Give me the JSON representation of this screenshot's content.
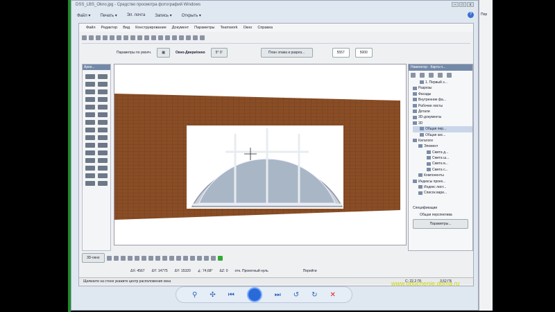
{
  "window": {
    "title": "DSS_LBS_Okno.jpg - Средство просмотра фотографий Windows"
  },
  "viewer_menu": [
    "Файл ▾",
    "Печать ▾",
    "Эл. почта",
    "Запись ▾",
    "Открыть ▾"
  ],
  "archicad": {
    "menu": [
      "Файл",
      "Редактор",
      "Вид",
      "Конструирование",
      "Документ",
      "Параметры",
      "Teamwork",
      "Окно",
      "Справка"
    ],
    "info": {
      "params_label": "Параметры по умолч.",
      "layer": "Окно-Двери/окно",
      "angle": "5° 0'",
      "plan_button": "План этажа и разрез...",
      "w": "5557",
      "h": "5000"
    },
    "toolbox_title": "Архи...",
    "navigator": {
      "title": "Навигатор - Карта п...",
      "items": [
        "1. Первый э...",
        "Разрезы",
        "Фасады",
        "Внутренние фа...",
        "Рабочие листы",
        "Детали",
        "3D-документы",
        "3D",
        "Общая пер...",
        "Общая акс...",
        "Каталоги",
        "Элемент",
        "Смета д...",
        "Смета ш...",
        "Смета в...",
        "Смета с...",
        "Компоненты",
        "Индексы проек...",
        "Индекс лист...",
        "Список вари..."
      ],
      "spec_label": "Спецификации",
      "view_label": "Общая перспектива",
      "params_button": "Параметры..."
    },
    "bottom": {
      "view3d": "3D-окно",
      "dx": "ΔX: 4567",
      "dy": "ΔY: 14775",
      "dr": "ΔY: 15320",
      "angle": "∡: 74,68°",
      "dz": "ΔZ: 0",
      "rel": "отн. Проектный нуль",
      "layer_menu": "Перейти"
    },
    "status": "Щелкните на стене укажите центр расположения окна",
    "disk": "C: 22,2 ГБ",
    "mem": "3,52 ГБ"
  },
  "watermark": "www.obuchenie.doma.ru",
  "right_window": "Пер"
}
